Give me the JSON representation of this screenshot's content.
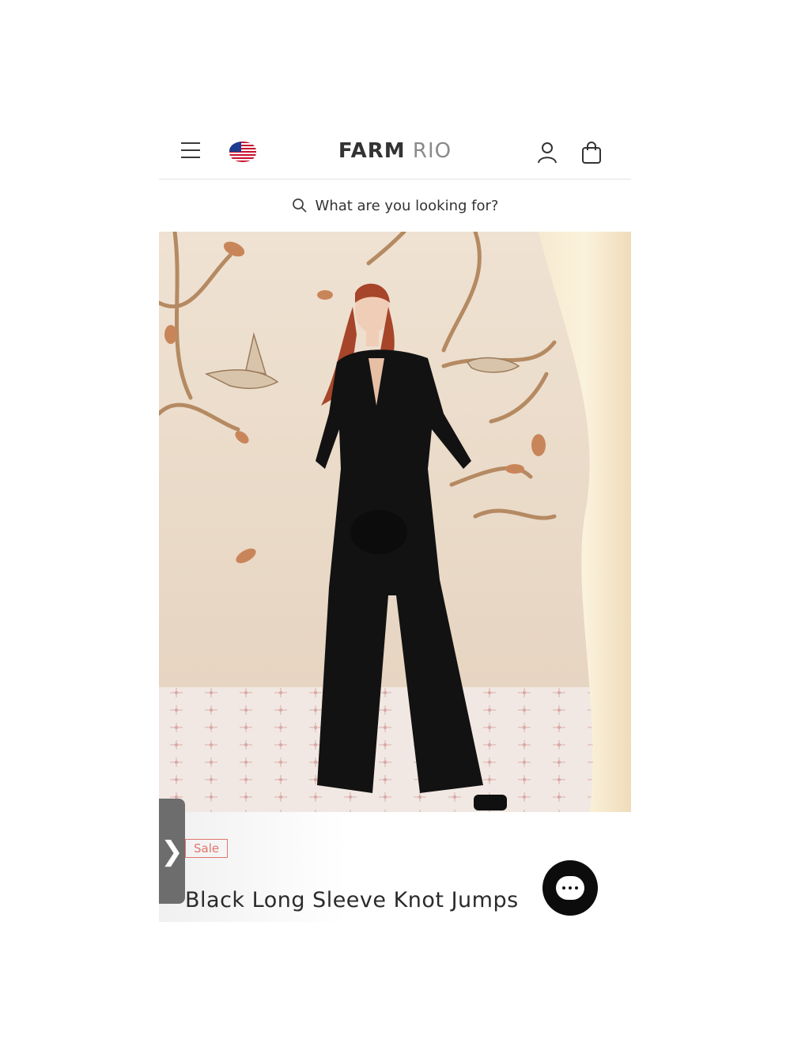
{
  "header": {
    "logo_primary": "FARM",
    "logo_secondary": "RIO"
  },
  "search": {
    "placeholder": "What are you looking for?"
  },
  "carousel": {
    "slide_count": 5,
    "active_index": 0
  },
  "product": {
    "badge": "Sale",
    "title": "Black Long Sleeve Knot Jumps"
  },
  "side_tab": {
    "glyph": "❯"
  },
  "icons": {
    "menu": "hamburger-icon",
    "flag": "us-flag-icon",
    "account": "user-icon",
    "bag": "shopping-bag-icon",
    "search": "search-icon",
    "chat": "chat-icon"
  },
  "colors": {
    "sale_badge": "#e0766c",
    "chat_button": "#0c0c0c",
    "side_tab": "#6d6d6d"
  }
}
